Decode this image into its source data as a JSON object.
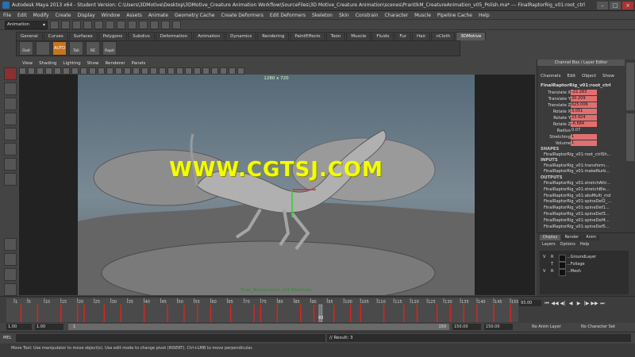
{
  "window": {
    "title": "Autodesk Maya 2013 x64 - Student Version: C:\\Users\\3DMotive\\Desktop\\3DMotive_Creature Animation Workflow\\SourceFiles\\3D Motive_Creature Animation\\scenes\\PrantikM_CreatureAnimation_v05_Polish.ma* --- FinalRaptorRig_v01:root_ctrl"
  },
  "menubar": [
    "File",
    "Edit",
    "Modify",
    "Create",
    "Display",
    "Window",
    "Assets",
    "Animate",
    "Geometry Cache",
    "Create Deformers",
    "Edit Deformers",
    "Skeleton",
    "Skin",
    "Constrain",
    "Character",
    "Muscle",
    "Pipeline Cache",
    "Help"
  ],
  "statusline": {
    "mode": "Animation"
  },
  "shelf": {
    "tabs": [
      "General",
      "Curves",
      "Surfaces",
      "Polygons",
      "Subdivs",
      "Deformation",
      "Animation",
      "Dynamics",
      "Rendering",
      "PaintEffects",
      "Toon",
      "Muscle",
      "Fluids",
      "Fur",
      "Hair",
      "nCloth",
      "3DMotive"
    ],
    "active_tab": "3DMotive",
    "buttons": [
      "Outl",
      "",
      "AUTO",
      "Tall",
      "RE",
      "Rapti"
    ]
  },
  "panel": {
    "menu": [
      "View",
      "Shading",
      "Lighting",
      "Show",
      "Renderer",
      "Panels"
    ],
    "resolution": "1280 x 720",
    "camera": "Final_BackGround_v01:MainCam",
    "watermark": "WWW.CGTSJ.COM"
  },
  "channel_box": {
    "header": "Channel Box / Layer Editor",
    "menu": [
      "Channels",
      "Edit",
      "Object",
      "Show"
    ],
    "object": "FinalRaptorRig_v01:root_ctrl",
    "attributes": [
      {
        "name": "Translate X",
        "value": "-22.283"
      },
      {
        "name": "Translate Y",
        "value": "30.209"
      },
      {
        "name": "Translate Z",
        "value": "625.006"
      },
      {
        "name": "Rotate X",
        "value": "3.051"
      },
      {
        "name": "Rotate Y",
        "value": "23.924"
      },
      {
        "name": "Rotate Z",
        "value": "-6.684"
      },
      {
        "name": "Radius",
        "value": "0.07"
      },
      {
        "name": "Stretching",
        "value": "1"
      },
      {
        "name": "Volume",
        "value": "1"
      }
    ],
    "shapes_label": "SHAPES",
    "shape": "FinalRaptorRig_v01:root_ctrlSh...",
    "inputs_label": "INPUTS",
    "inputs": [
      "FinalRaptorRig_v01:transform...",
      "FinalRaptorRig_v01:makeNurb..."
    ],
    "outputs_label": "OUTPUTS",
    "outputs": [
      "FinalRaptorRig_v01:stretchAttr...",
      "FinalRaptorRig_v01:stretchBle...",
      "FinalRaptorRig_v01:absMulti_md",
      "FinalRaptorRig_v01:spineDef2_...",
      "FinalRaptorRig_v01:spineDef1...",
      "FinalRaptorRig_v01:spineDef3...",
      "FinalRaptorRig_v01:spineDef4...",
      "FinalRaptorRig_v01:spineDef5..."
    ]
  },
  "side_tabs": [
    "Channel Box / Layer Editor",
    "Attribute Editor"
  ],
  "layer_editor": {
    "tabs": [
      "Display",
      "Render",
      "Anim"
    ],
    "active_tab": "Display",
    "menu": [
      "Layers",
      "Options",
      "Help"
    ],
    "layers": [
      {
        "v": "V",
        "t": "R",
        "name": "...GroundLayer"
      },
      {
        "v": "",
        "t": "T",
        "name": "...Foliage"
      },
      {
        "v": "V",
        "t": "R",
        "name": "...Mesh"
      }
    ]
  },
  "timeline": {
    "ticks": [
      "1",
      "5",
      "10",
      "15",
      "20",
      "25",
      "30",
      "35",
      "40",
      "45",
      "50",
      "55",
      "60",
      "65",
      "70",
      "75",
      "80",
      "85",
      "90",
      "95",
      "100",
      "105",
      "110",
      "115",
      "120",
      "125",
      "130",
      "135",
      "140",
      "145",
      "150"
    ],
    "current_frame": "93.00",
    "playhead_label": "93",
    "keys": [
      3,
      8,
      15,
      20,
      22,
      28,
      33,
      40,
      47,
      52,
      56,
      60,
      66,
      73,
      75,
      80,
      87,
      91,
      97,
      102,
      105,
      112,
      118,
      122,
      128,
      132,
      136,
      140,
      145,
      150
    ]
  },
  "playback": [
    "⏮",
    "◀◀",
    "◀|",
    "◀",
    "▶",
    "|▶",
    "▶▶",
    "⏭"
  ],
  "range": {
    "start": "1.00",
    "min": "1.00",
    "bar_start": "1",
    "bar_end": "150",
    "end": "150.00",
    "max": "150.00",
    "anim_layer": "No Anim Layer",
    "character": "No Character Set"
  },
  "cmdline": {
    "lang": "MEL",
    "result": "// Result: 3"
  },
  "helpline": "Move Tool: Use manipulator to move object(s). Use edit mode to change pivot (INSERT). Ctrl+LMB to move perpendicular."
}
